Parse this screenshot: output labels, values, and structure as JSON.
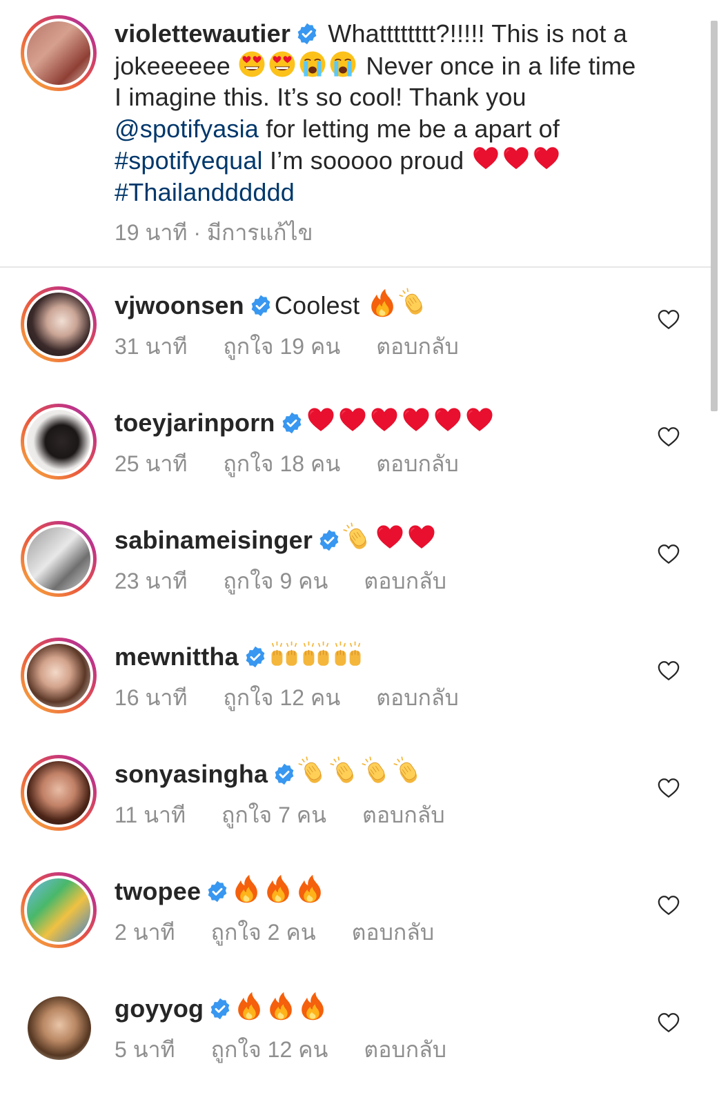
{
  "caption": {
    "username": "violettewautier",
    "text_1": "Whatttttttt?!!!!! This is not a jokeeeeee",
    "emojis_1": [
      "heart-eyes-emoji",
      "heart-eyes-emoji",
      "loudly-crying-emoji",
      "loudly-crying-emoji"
    ],
    "text_2": " Never once in a life time I imagine this. It’s so cool! Thank you  ",
    "mention": "@spotifyasia",
    "text_3": " for letting me be a apart of ",
    "hashtag_1": "#spotifyequal",
    "text_4": " I’m sooooo proud ",
    "emojis_2": [
      "red-heart-emoji",
      "red-heart-emoji",
      "red-heart-emoji"
    ],
    "hashtag_2": "#Thailandddddd",
    "meta": "19 นาที · มีการแก้ไข"
  },
  "comments": [
    {
      "username": "vjwoonsen",
      "text": "Coolest",
      "emojis": [
        "fire",
        "clap"
      ],
      "time": "31 นาที",
      "likes": "ถูกใจ 19 คน",
      "reply": "ตอบกลับ"
    },
    {
      "username": "toeyjarinporn",
      "text": "",
      "emojis": [
        "heart",
        "heart",
        "heart",
        "heart",
        "heart",
        "heart"
      ],
      "time": "25 นาที",
      "likes": "ถูกใจ 18 คน",
      "reply": "ตอบกลับ"
    },
    {
      "username": "sabinameisinger",
      "text": "",
      "emojis": [
        "clap",
        "heart",
        "heart"
      ],
      "time": "23 นาที",
      "likes": "ถูกใจ 9 คน",
      "reply": "ตอบกลับ"
    },
    {
      "username": "mewnittha",
      "text": "",
      "emojis": [
        "raised-hands",
        "raised-hands",
        "raised-hands"
      ],
      "time": "16 นาที",
      "likes": "ถูกใจ 12 คน",
      "reply": "ตอบกลับ"
    },
    {
      "username": "sonyasingha",
      "text": "",
      "emojis": [
        "clap",
        "clap",
        "clap",
        "clap"
      ],
      "time": "11 นาที",
      "likes": "ถูกใจ 7 คน",
      "reply": "ตอบกลับ"
    },
    {
      "username": "twopee",
      "text": "",
      "emojis": [
        "fire",
        "fire",
        "fire"
      ],
      "time": "2 นาที",
      "likes": "ถูกใจ 2 คน",
      "reply": "ตอบกลับ"
    },
    {
      "username": "goyyog",
      "text": "",
      "emojis": [
        "fire",
        "fire",
        "fire"
      ],
      "time": "5 นาที",
      "likes": "ถูกใจ 12 คน",
      "reply": "ตอบกลับ"
    }
  ],
  "colors": {
    "link": "#00376b",
    "verified": "#3897f0",
    "meta_text": "#8e8e8e",
    "heart_emoji": "#e8102e",
    "fire_emoji": "#f4600c",
    "clap_emoji": "#f4b63b"
  }
}
